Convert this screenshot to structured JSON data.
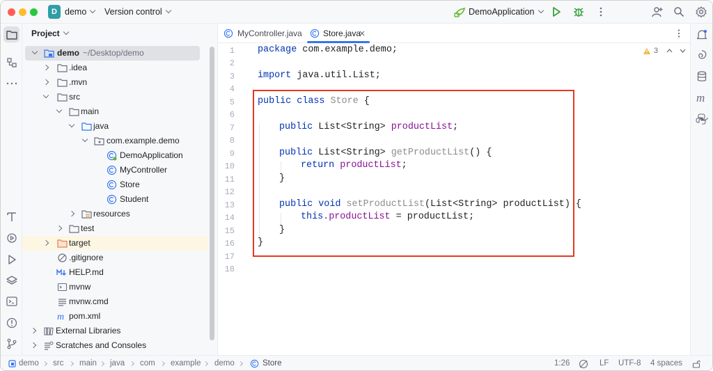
{
  "titlebar": {
    "project_badge": "D",
    "project_name": "demo",
    "vcs_label": "Version control",
    "run_config": "DemoApplication"
  },
  "project_panel": {
    "title": "Project",
    "tree": [
      {
        "label": "demo",
        "path": "~/Desktop/demo"
      },
      {
        "label": ".idea"
      },
      {
        "label": ".mvn"
      },
      {
        "label": "src"
      },
      {
        "label": "main"
      },
      {
        "label": "java"
      },
      {
        "label": "com.example.demo"
      },
      {
        "label": "DemoApplication"
      },
      {
        "label": "MyController"
      },
      {
        "label": "Store"
      },
      {
        "label": "Student"
      },
      {
        "label": "resources"
      },
      {
        "label": "test"
      },
      {
        "label": "target"
      },
      {
        "label": ".gitignore"
      },
      {
        "label": "HELP.md"
      },
      {
        "label": "mvnw"
      },
      {
        "label": "mvnw.cmd"
      },
      {
        "label": "pom.xml"
      },
      {
        "label": "External Libraries"
      },
      {
        "label": "Scratches and Consoles"
      }
    ]
  },
  "editor": {
    "tabs": [
      {
        "label": "MyController.java"
      },
      {
        "label": "Store.java",
        "active": true
      }
    ],
    "warning_count": "3",
    "lines": [
      "1",
      "2",
      "3",
      "4",
      "5",
      "6",
      "7",
      "8",
      "9",
      "10",
      "11",
      "12",
      "13",
      "14",
      "15",
      "16",
      "17",
      "18"
    ]
  },
  "code": {
    "l1_kw": "package",
    "l1_rest": " com.example.demo;",
    "l3_kw": "import",
    "l3_rest": " java.util.List;",
    "l5_kw": "public class",
    "l5_name": " Store",
    "l5_rest": " {",
    "l7_kw": "public",
    "l7_type": " List<String> ",
    "l7_field": "productList",
    "l7_end": ";",
    "l9_kw": "public",
    "l9_type": " List<String> ",
    "l9_method": "getProductList",
    "l9_end": "() {",
    "l10_kw": "return",
    "l10_field": " productList",
    "l10_end": ";",
    "l11": "}",
    "l13_kw": "public void",
    "l13_method": " setProductList",
    "l13_end": "(List<String> productList) {",
    "l14_kw": "this",
    "l14_field": ".productList",
    "l14_end": " = productList;",
    "l15": "}",
    "l16": "}"
  },
  "statusbar": {
    "breadcrumbs": [
      "demo",
      "src",
      "main",
      "java",
      "com",
      "example",
      "demo",
      "Store"
    ],
    "position": "1:26",
    "line_ending": "LF",
    "encoding": "UTF-8",
    "indent": "4 spaces"
  },
  "colors": {
    "accent": "#3574f0",
    "highlight_box": "#e2391f",
    "keyword": "#0033b3",
    "field": "#871094",
    "method": "#00627a"
  }
}
